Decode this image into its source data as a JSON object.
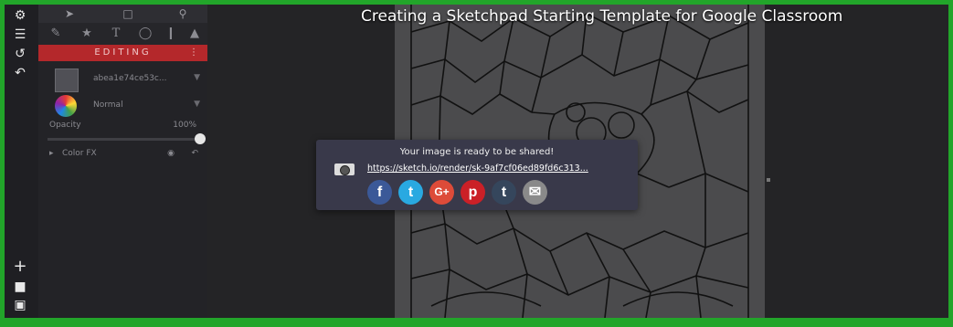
{
  "video": {
    "title": "Creating a Sketchpad Starting Template for Google Classroom"
  },
  "panel": {
    "editing_label": "EDITING",
    "editing_menu": "⋮",
    "layer_name": "abea1e74ce53c...",
    "blend_mode": "Normal",
    "opacity_label": "Opacity",
    "opacity_value": "100%",
    "color_fx_label": "Color FX",
    "color_fx_arrow": "▸"
  },
  "share_dialog": {
    "message": "Your image is ready to be shared!",
    "url": "https://sketch.io/render/sk-9af7cf06ed89fd6c313..."
  },
  "social": [
    {
      "label": "f",
      "name": "facebook",
      "color": "#3b5998"
    },
    {
      "label": "t",
      "name": "twitter",
      "color": "#29a9e1"
    },
    {
      "label": "G+",
      "name": "google-plus",
      "color": "#dd4b39"
    },
    {
      "label": "p",
      "name": "pinterest",
      "color": "#cb2027"
    },
    {
      "label": "t",
      "name": "tumblr",
      "color": "#35465c"
    },
    {
      "label": "✉",
      "name": "email",
      "color": "#8a8a8a"
    }
  ],
  "colors": {
    "border": "#22a52a",
    "editing_bar": "#b4282b"
  }
}
